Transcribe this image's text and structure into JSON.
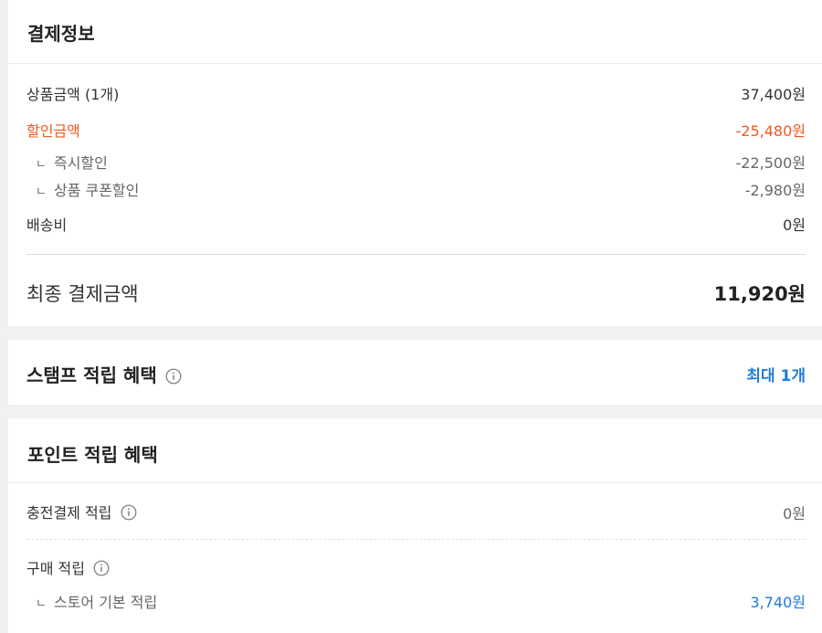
{
  "payment": {
    "title": "결제정보",
    "product_amount": {
      "label": "상품금액 (1개)",
      "value": "37,400원"
    },
    "discount_amount": {
      "label": "할인금액",
      "value": "-25,480원"
    },
    "instant_discount": {
      "prefix": "ㄴ",
      "label": "즉시할인",
      "value": "-22,500원"
    },
    "coupon_discount": {
      "prefix": "ㄴ",
      "label": "상품 쿠폰할인",
      "value": "-2,980원"
    },
    "shipping": {
      "label": "배송비",
      "value": "0원"
    },
    "final": {
      "label": "최종 결제금액",
      "value": "11,920원"
    }
  },
  "stamp": {
    "title": "스탬프 적립 혜택",
    "value": "최대 1개"
  },
  "points": {
    "title": "포인트 적립 혜택",
    "charge": {
      "label": "충전결제 적립",
      "value": "0원"
    },
    "purchase": {
      "label": "구매 적립"
    },
    "store_basic": {
      "prefix": "ㄴ",
      "label": "스토어 기본 적립",
      "value": "3,740원"
    }
  },
  "colors": {
    "discount": "#f0581f",
    "accent_blue": "#1e7bd8"
  },
  "icons": [
    "info-icon"
  ]
}
